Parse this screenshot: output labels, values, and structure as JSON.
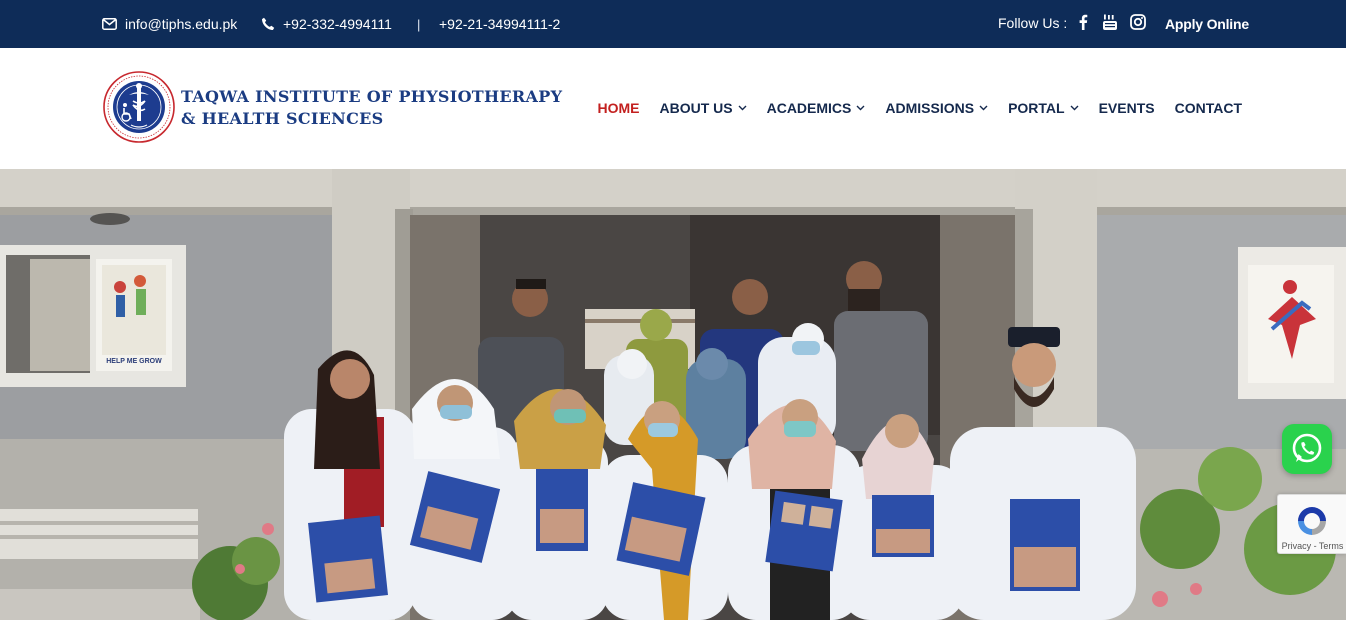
{
  "topbar": {
    "email": "info@tiphs.edu.pk",
    "phone1": "+92-332-4994111",
    "separator": "|",
    "phone2": "+92-21-34994111-2",
    "follow_label": "Follow Us :",
    "social_icons": [
      "facebook-icon",
      "youtube-icon",
      "instagram-icon"
    ],
    "apply_label": "Apply Online"
  },
  "logo": {
    "line1": "TAQWA INSTITUTE  OF PHYSIOTHERAPY",
    "line2": "& HEALTH  SCIENCES"
  },
  "nav": {
    "items": [
      {
        "label": "HOME",
        "active": true,
        "dropdown": false
      },
      {
        "label": "ABOUT US",
        "active": false,
        "dropdown": true
      },
      {
        "label": "ACADEMICS",
        "active": false,
        "dropdown": true
      },
      {
        "label": "ADMISSIONS",
        "active": false,
        "dropdown": true
      },
      {
        "label": "PORTAL",
        "active": false,
        "dropdown": true
      },
      {
        "label": "EVENTS",
        "active": false,
        "dropdown": false
      },
      {
        "label": "CONTACT",
        "active": false,
        "dropdown": false
      }
    ]
  },
  "hero": {
    "poster_caption": "HELP ME GROW"
  },
  "recaptcha": {
    "text": "Privacy - Terms"
  },
  "colors": {
    "topbar_bg": "#0e2c58",
    "nav_text": "#15294d",
    "nav_active": "#c3201f",
    "logo_blue": "#1b3c82",
    "whatsapp": "#2ad24d"
  }
}
